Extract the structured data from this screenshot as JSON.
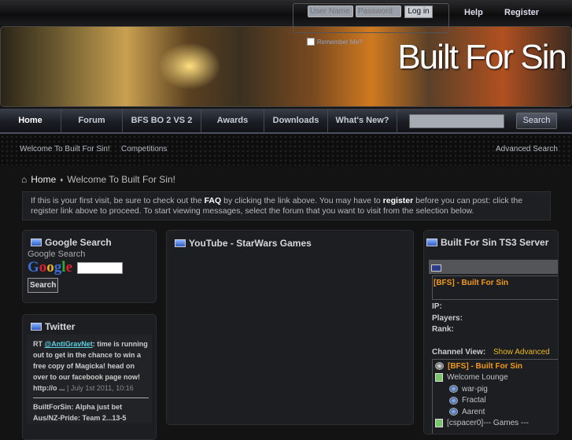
{
  "login": {
    "username_placeholder": "User Name",
    "password_placeholder": "Password",
    "login_label": "Log in",
    "remember_label": "Remember Me?"
  },
  "top_links": {
    "help": "Help",
    "register": "Register"
  },
  "banner": {
    "brand": "Built For Sin"
  },
  "nav": {
    "items": [
      "Home",
      "Forum",
      "BFS BO 2 VS 2",
      "Awards",
      "Downloads",
      "What's New?"
    ],
    "search_label": "Search"
  },
  "subnav": {
    "items": [
      "Welcome To Built For Sin!",
      "Competitions"
    ],
    "advanced_search": "Advanced Search"
  },
  "breadcrumb": {
    "home": "Home",
    "current": "Welcome To Built For Sin!"
  },
  "notice": {
    "p1": "If this is your first visit, be sure to check out the ",
    "faq": "FAQ",
    "p2": " by clicking the link above. You may have to ",
    "register": "register",
    "p3": " before you can post: click the register link above to proceed. To start viewing messages, select the forum that you want to visit from the selection below."
  },
  "google_panel": {
    "title": "Google Search",
    "subtitle": "Google Search",
    "logo": "Google",
    "search_button": "Search"
  },
  "twitter_panel": {
    "title": "Twitter",
    "tweets": [
      {
        "prefix": "RT ",
        "mention": "@AntiGravNet",
        "text": ": time is running out to get in the chance to win a free copy of Magicka! head on over to our facebook page now! http://o ... ",
        "date": "| July 1st 2011, 10:16"
      },
      {
        "text": "BuiltForSin: Alpha just bet Aus/NZ-Pride: Team 2...13-5"
      }
    ]
  },
  "youtube_panel": {
    "title": "YouTube - StarWars Games"
  },
  "ts3_panel": {
    "title": "Built For Sin TS3 Server",
    "server_name": "[BFS] - Built For Sin",
    "ip_label": "IP:",
    "players_label": "Players:",
    "rank_label": "Rank:",
    "channel_view_label": "Channel View:",
    "show_advanced": "Show Advanced",
    "tree": {
      "server": "[BFS] - Built For Sin",
      "channels": [
        {
          "name": "Welcome Lounge",
          "users": [
            "war-pig",
            "Fractal",
            "Aarent"
          ]
        },
        {
          "name": "[cspacer0]--- Games ---",
          "users": []
        }
      ]
    }
  }
}
